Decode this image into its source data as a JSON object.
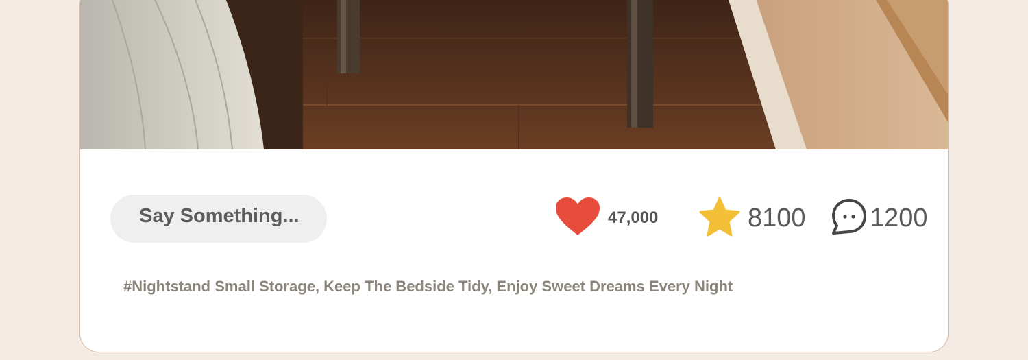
{
  "post": {
    "comment_placeholder": "Say Something...",
    "hashtags": "#Nightstand Small Storage, Keep The Bedside Tidy, Enjoy Sweet Dreams Every Night"
  },
  "stats": {
    "likes": "47,000",
    "favorites": "8100",
    "comments": "1200"
  },
  "icons": {
    "like": "heart-icon",
    "favorite": "star-icon",
    "comment": "chat-bubble-icon"
  },
  "colors": {
    "heart": "#e84c3d",
    "star": "#f2bf37",
    "page_background": "#f4ebe5"
  }
}
